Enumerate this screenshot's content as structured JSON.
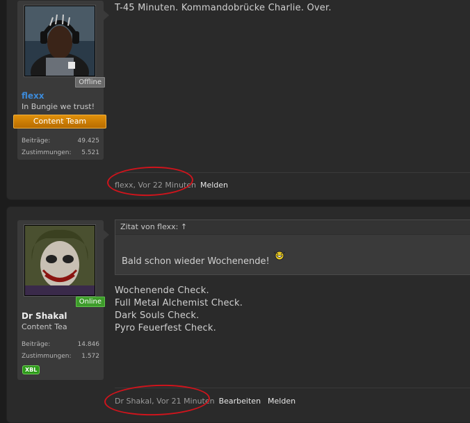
{
  "posts": [
    {
      "author": {
        "name": "flexx",
        "status": "Offline",
        "title": "In Bungie we trust!",
        "rank": "Content Team",
        "stats": [
          {
            "label": "Beiträge:",
            "value": "49.425"
          },
          {
            "label": "Zustimmungen:",
            "value": "5.521"
          }
        ]
      },
      "message": [
        "T-45 Minuten. Kommandobrücke Charlie. Over."
      ],
      "footer": {
        "meta": "flexx, Vor 22 Minuten",
        "links": [
          "Melden"
        ]
      }
    },
    {
      "author": {
        "name": "Dr Shakal",
        "status": "Online",
        "title": "Content Tea",
        "stats": [
          {
            "label": "Beiträge:",
            "value": "14.846"
          },
          {
            "label": "Zustimmungen:",
            "value": "1.572"
          }
        ],
        "badge": "XBL"
      },
      "quote": {
        "header": "Zitat von flexx: ↑",
        "text": "Bald schon wieder Wochenende!"
      },
      "message": [
        "Wochenende Check.",
        "Full Metal Alchemist Check.",
        "Dark Souls Check.",
        "Pyro Feuerfest Check."
      ],
      "footer": {
        "meta": "Dr Shakal, Vor 21 Minuten",
        "links": [
          "Bearbeiten",
          "Melden"
        ]
      }
    }
  ],
  "colors": {
    "username_blue": "#3c8ad9",
    "rank_orange": "#e0900a",
    "online_green": "#3d9c2a",
    "highlight_red": "#d0141c"
  }
}
